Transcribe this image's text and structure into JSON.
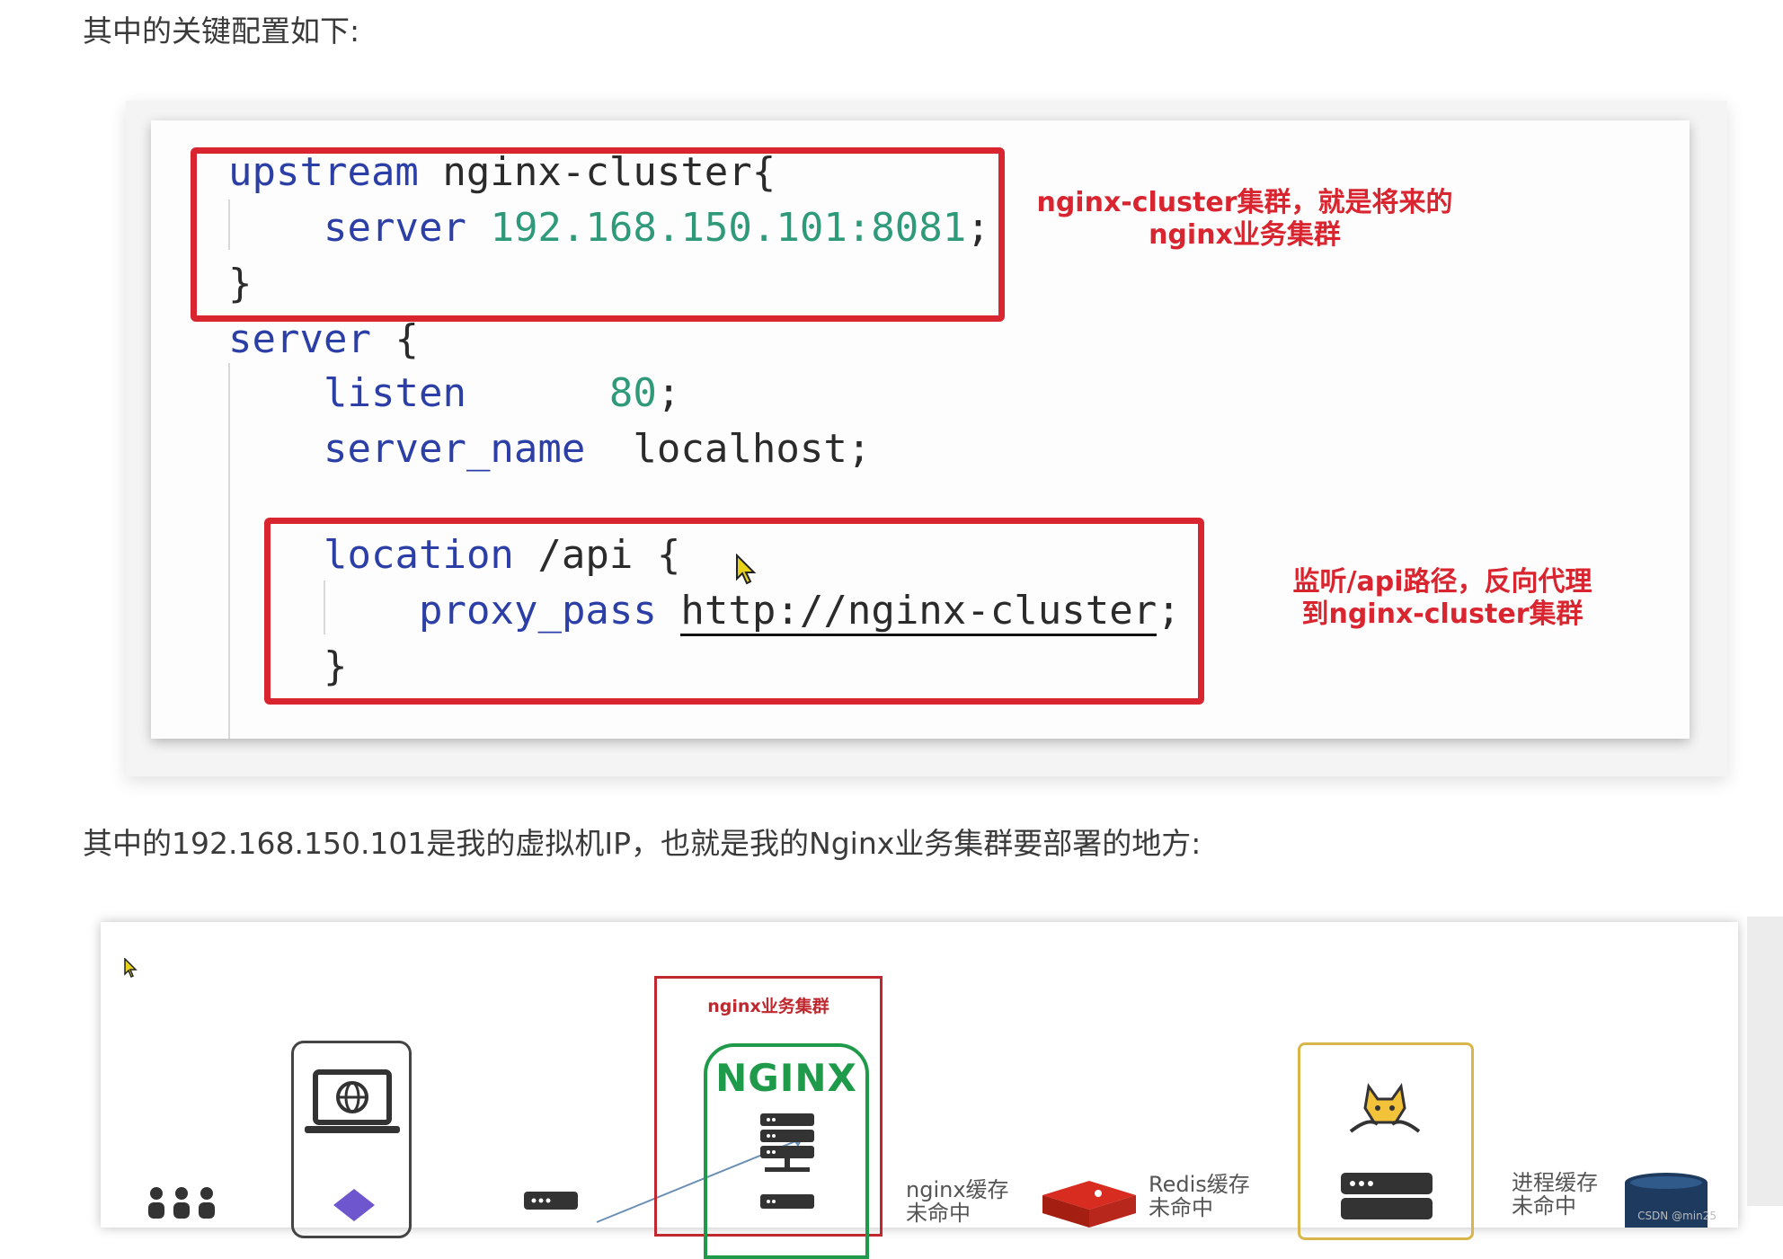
{
  "intro_text": "其中的关键配置如下:",
  "code": {
    "line1": {
      "kw": "upstream",
      "rest": " nginx-cluster{"
    },
    "line2": {
      "kw": "server",
      "num": "192.168.150.101:8081",
      "end": ";"
    },
    "line3": "}",
    "line4": {
      "kw": "server",
      "rest": " {"
    },
    "line5": {
      "kw": "listen",
      "num": "80",
      "end": ";"
    },
    "line6": {
      "kw": "server_name",
      "rest": "localhost;"
    },
    "line7": {
      "kw": "location",
      "rest": " /api {"
    },
    "line8": {
      "kw": "proxy_pass",
      "url": "http://nginx-cluster",
      "end": ";"
    },
    "line9": "}"
  },
  "annotations": {
    "a1_line1": "nginx-cluster集群，就是将来的",
    "a1_line2": "nginx业务集群",
    "a2_line1": "监听/api路径，反向代理",
    "a2_line2": "到nginx-cluster集群"
  },
  "desc_text": "其中的192.168.150.101是我的虚拟机IP，也就是我的Nginx业务集群要部署的地方:",
  "diagram": {
    "cluster_title": "nginx业务集群",
    "nginx_logo": "NGINX",
    "label_nginx_cache": "nginx缓存",
    "label_nginx_cache_2": "未命中",
    "label_redis_cache": "Redis缓存",
    "label_redis_cache_2": "未命中",
    "label_process_cache": "进程缓存",
    "label_process_cache_2": "未命中",
    "watermark": "CSDN @min25"
  },
  "colors": {
    "highlight_red": "#d9252f",
    "keyword_blue": "#2b3fa6",
    "number_teal": "#2f9a7a",
    "nginx_green": "#1f9a4a",
    "tomcat_gold": "#d9b64a"
  }
}
